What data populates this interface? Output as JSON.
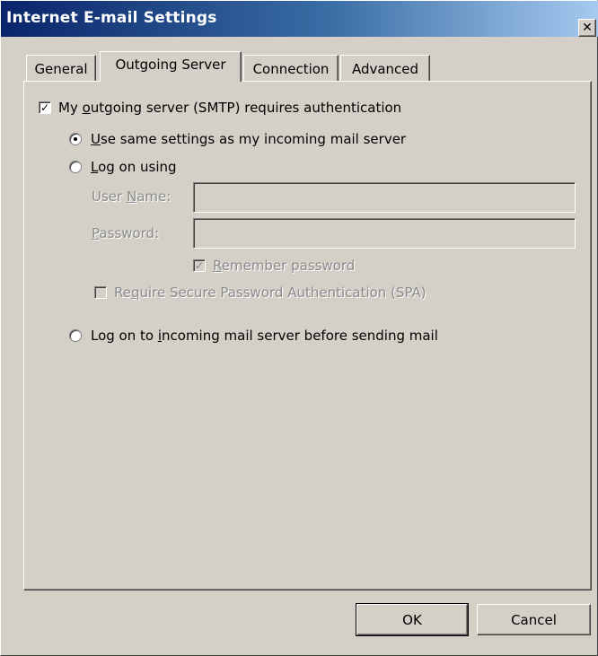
{
  "window": {
    "title": "Internet E-mail Settings",
    "close_glyph": "✕"
  },
  "tabs": [
    {
      "label": "General",
      "active": false
    },
    {
      "label": "Outgoing Server",
      "active": true
    },
    {
      "label": "Connection",
      "active": false
    },
    {
      "label": "Advanced",
      "active": false
    }
  ],
  "outgoing": {
    "requires_auth": {
      "label": "My outgoing server (SMTP) requires authentication",
      "checked": true
    },
    "radio_same_settings": {
      "label": "Use same settings as my incoming mail server",
      "checked": true
    },
    "radio_log_on_using": {
      "label": "Log on using",
      "checked": false
    },
    "user_name": {
      "label": "User Name:",
      "value": ""
    },
    "password": {
      "label": "Password:",
      "value": ""
    },
    "remember_password": {
      "label": "Remember password",
      "checked": true,
      "enabled": false
    },
    "require_spa": {
      "label": "Require Secure Password Authentication (SPA)",
      "checked": false,
      "enabled": false
    },
    "radio_log_on_incoming": {
      "label": "Log on to incoming mail server before sending mail",
      "checked": false
    }
  },
  "buttons": {
    "ok": "OK",
    "cancel": "Cancel"
  },
  "colors": {
    "dialog_face": "#d4d0c8",
    "title_gradient_start": "#0a246a",
    "title_gradient_end": "#a6caf0",
    "disabled_text": "#8a8a8a"
  },
  "icons": {
    "close": "close-icon",
    "check": "checkmark-icon",
    "radio_dot": "radio-dot-icon"
  }
}
